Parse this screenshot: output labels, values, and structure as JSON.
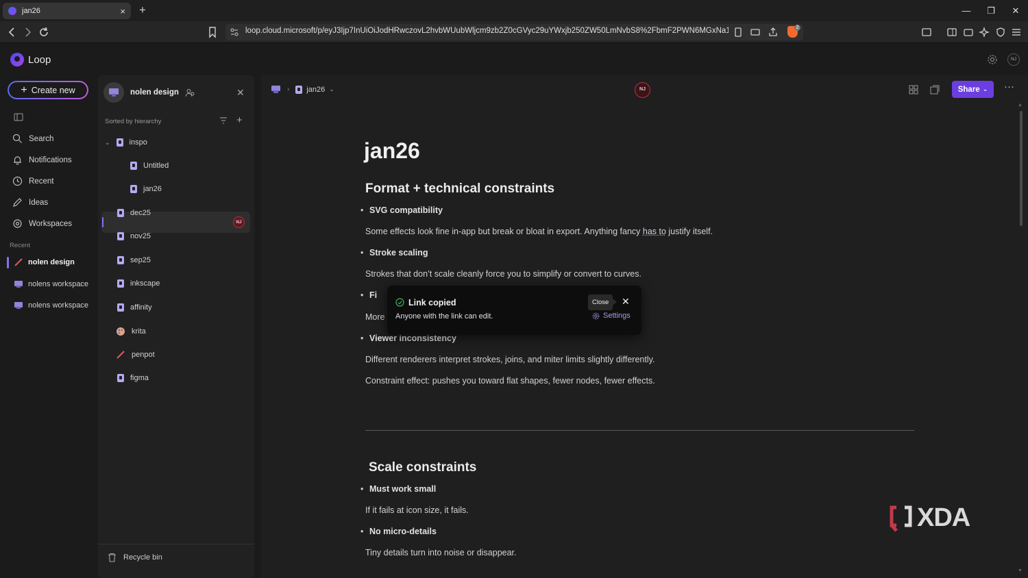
{
  "browser": {
    "tab_title": "jan26",
    "tab_close": "×",
    "new_tab": "+",
    "url": "loop.cloud.microsoft/p/eyJ3Ijp7InUiOiJodHRwczovL2hvbWUubWljcm9zb2Z0cGVyc29uYWxjb250ZW50LmNvbS8%2FbmF2PWN6MGxNa1ltWkQx...",
    "brave_badge": "2"
  },
  "app": {
    "name": "Loop",
    "user_initials": "NJ",
    "create_new": "Create new",
    "nav": [
      {
        "label": "Search",
        "icon": "search-icon"
      },
      {
        "label": "Notifications",
        "icon": "bell-icon"
      },
      {
        "label": "Recent",
        "icon": "clock-icon"
      },
      {
        "label": "Ideas",
        "icon": "pencil-icon"
      },
      {
        "label": "Workspaces",
        "icon": "workspaces-icon"
      }
    ],
    "recent_heading": "Recent",
    "recent": [
      {
        "label": "nolen design",
        "icon": "brush-icon",
        "active": true
      },
      {
        "label": "nolens workspace",
        "icon": "workspace-icon",
        "active": false
      },
      {
        "label": "nolens workspace",
        "icon": "workspace-icon",
        "active": false
      }
    ]
  },
  "tree": {
    "workspace_name": "nolen design",
    "sorted_label": "Sorted by hierarchy",
    "items": [
      {
        "label": "inspo"
      },
      {
        "label": "Untitled"
      },
      {
        "label": "jan26",
        "badge": "NJ"
      },
      {
        "label": "dec25"
      },
      {
        "label": "nov25"
      },
      {
        "label": "sep25"
      },
      {
        "label": "inkscape"
      },
      {
        "label": "affinity"
      },
      {
        "label": "krita"
      },
      {
        "label": "penpot"
      },
      {
        "label": "figma"
      }
    ],
    "recycle_bin": "Recycle bin"
  },
  "doc": {
    "breadcrumb_page": "jan26",
    "presence_initials": "NJ",
    "share_label": "Share",
    "more_label": "···",
    "title": "jan26",
    "section1_heading": "Format + technical constraints",
    "bullet_svg": "SVG compatibility",
    "para_svg_a": "Some effects look fine in-app but break or bloat in export. Anything fancy ",
    "para_svg_b": "has to",
    "para_svg_c": " justify itself.",
    "bullet_stroke": "Stroke scaling",
    "para_stroke": "Strokes that don’t scale cleanly force you to simplify or convert to curves.",
    "bullet_partial": "Fi",
    "para_partial": "More",
    "bullet_viewer": "Viewer inconsistency",
    "para_viewer": "Different renderers interpret strokes, joins, and miter limits slightly differently.",
    "para_constraint": "Constraint effect: pushes you toward flat shapes, fewer nodes, fewer effects.",
    "section2_heading": "Scale constraints",
    "bullet_small": "Must work small",
    "para_small": "If it fails at icon size, it fails.",
    "bullet_micro": "No micro-details",
    "para_micro": "Tiny details turn into noise or disappear."
  },
  "toast": {
    "title": "Link copied",
    "message": "Anyone with the link can edit.",
    "close_tooltip": "Close",
    "close_x": "✕",
    "settings": "Settings"
  },
  "watermark": "XDA",
  "colors": {
    "accent": "#6b3ee0",
    "link": "#a99af5",
    "presence": "#b83340"
  }
}
